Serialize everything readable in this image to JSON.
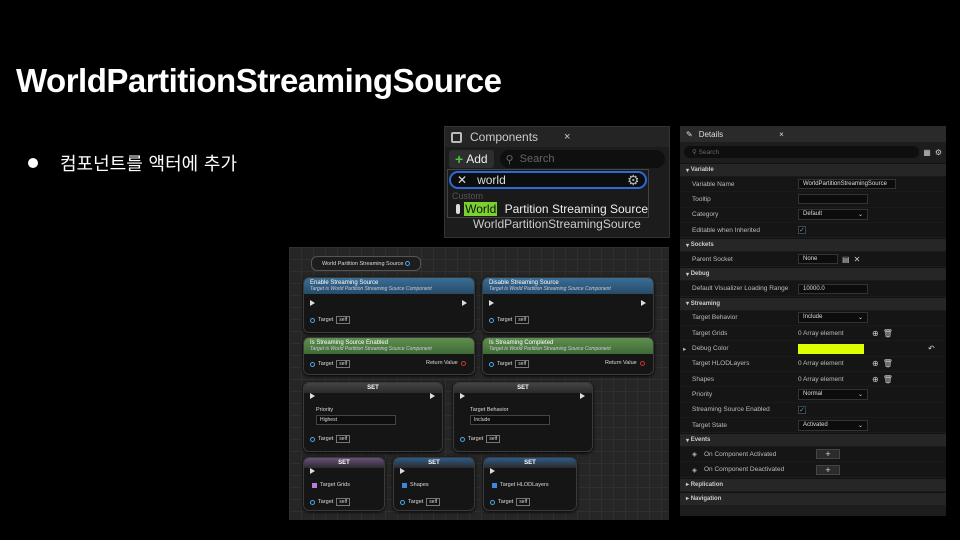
{
  "title": "WorldPartitionStreamingSource",
  "bullet": "컴포넌트를 액터에 추가",
  "components": {
    "tab": "Components",
    "close": "×",
    "add": "Add",
    "search_placeholder": "Search",
    "query": "world",
    "category": "Custom",
    "result_highlight": "World",
    "result_rest": " Partition Streaming Source",
    "child": "WorldPartitionStreamingSource"
  },
  "blueprint": {
    "ref_node": "World Partition Streaming Source",
    "nodes": [
      {
        "title": "Enable Streaming Source",
        "sub": "Target is World Partition Streaming Source Component"
      },
      {
        "title": "Disable Streaming Source",
        "sub": "Target is World Partition Streaming Source Component"
      },
      {
        "title": "Is Streaming Source Enabled",
        "sub": "Target is World Partition Streaming Source Component"
      },
      {
        "title": "Is Streaming Completed",
        "sub": "Target is World Partition Streaming Source Component"
      }
    ],
    "target": "Target",
    "self": "self",
    "return_value": "Return Value",
    "set": "SET",
    "priority": "Priority",
    "priority_val": "Highest",
    "target_behavior": "Target Behavior",
    "target_behavior_val": "Include",
    "target_grids": "Target Grids",
    "shapes": "Shapes",
    "target_hlod": "Target HLODLayers"
  },
  "details": {
    "tab": "Details",
    "search_placeholder": "Search",
    "sections": {
      "variable": "Variable",
      "sockets": "Sockets",
      "debug": "Debug",
      "streaming": "Streaming",
      "events": "Events",
      "replication": "Replication",
      "navigation": "Navigation"
    },
    "rows": {
      "variable_name": "Variable Name",
      "variable_name_val": "WorldPartitionStreamingSource",
      "tooltip": "Tooltip",
      "category": "Category",
      "category_val": "Default",
      "editable": "Editable when Inherited",
      "parent_socket": "Parent Socket",
      "parent_socket_val": "None",
      "loading_range": "Default Visualizer Loading Range",
      "loading_range_val": "10000.0",
      "target_behavior": "Target Behavior",
      "target_behavior_val": "Include",
      "target_grids": "Target Grids",
      "array": "0 Array element",
      "debug_color": "Debug Color",
      "target_hlod": "Target HLODLayers",
      "shapes": "Shapes",
      "priority": "Priority",
      "priority_val": "Normal",
      "streaming_enabled": "Streaming Source Enabled",
      "target_state": "Target State",
      "target_state_val": "Activated",
      "on_activated": "On Component Activated",
      "on_deactivated": "On Component Deactivated"
    },
    "debug_color_hex": "#DDFF00"
  }
}
